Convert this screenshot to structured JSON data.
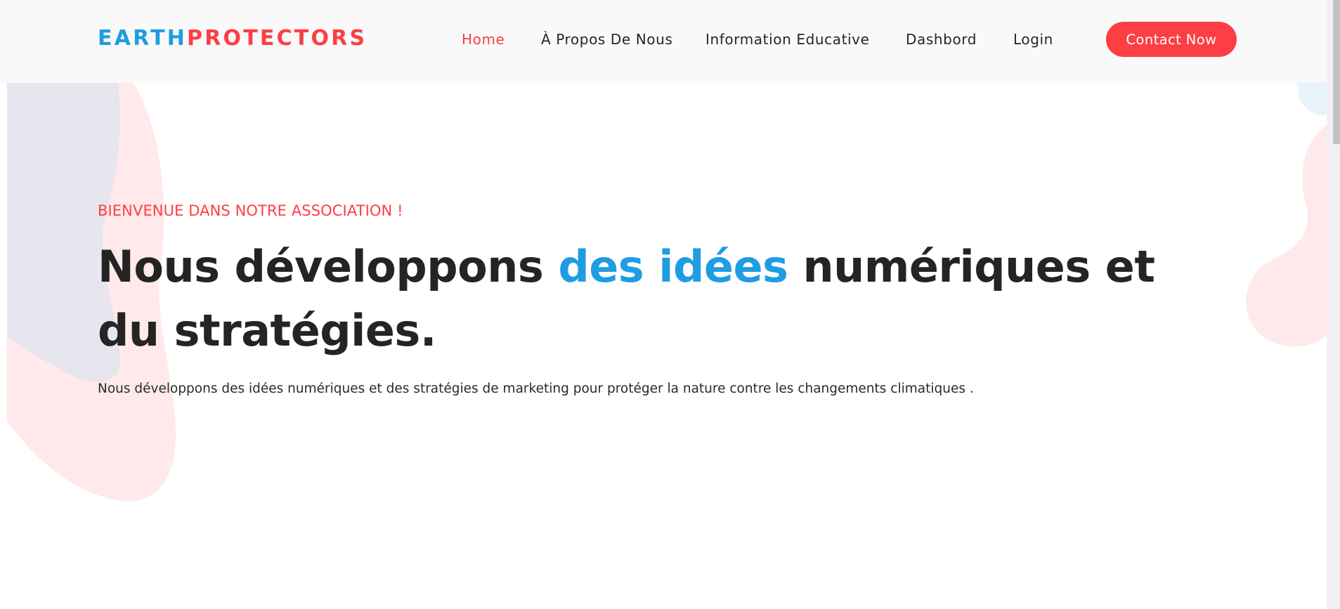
{
  "brand": {
    "part1": "EARTH",
    "part2": "PROTECTORS"
  },
  "nav": {
    "items": [
      {
        "label": "Home",
        "active": true
      },
      {
        "label": "À Propos De Nous",
        "active": false
      },
      {
        "label": "Information Educative",
        "active": false
      },
      {
        "label": "Dashbord",
        "active": false
      },
      {
        "label": "Login",
        "active": false
      }
    ],
    "cta_label": "Contact Now"
  },
  "hero": {
    "kicker": "BIENVENUE DANS NOTRE ASSOCIATION !",
    "headline_before": "Nous développons ",
    "headline_highlight": "des idées",
    "headline_after": " numériques et du stratégies.",
    "lead": "Nous développons des idées numériques et des stratégies de marketing pour protéger la nature contre les changements climatiques ."
  },
  "colors": {
    "accent_red": "#fd3e43",
    "accent_blue": "#1e9de3",
    "header_bg": "#f9f9f9",
    "text_dark": "#242424"
  }
}
